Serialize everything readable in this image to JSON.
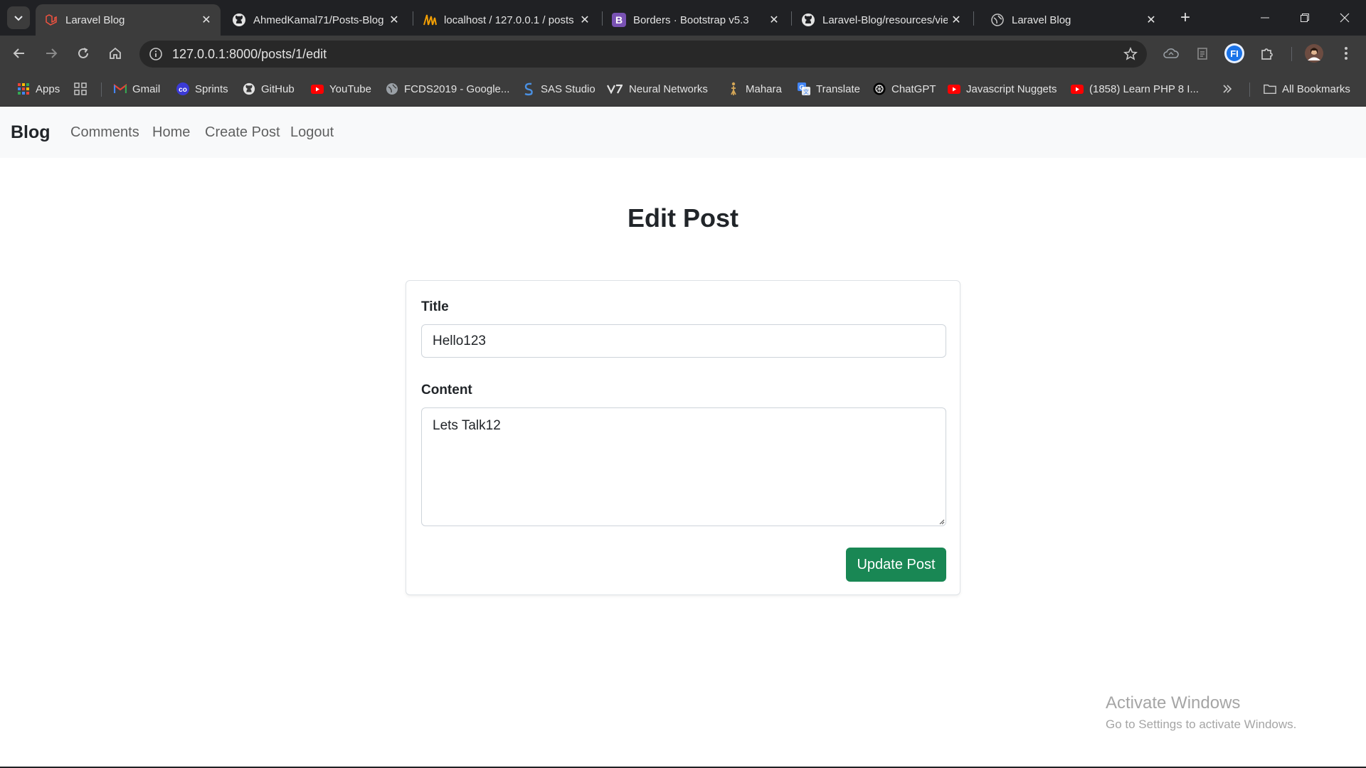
{
  "browser": {
    "tabs": [
      {
        "title": "Laravel Blog",
        "icon": "laravel-icon",
        "active": true
      },
      {
        "title": "AhmedKamal71/Posts-Blog",
        "icon": "github-icon",
        "active": false
      },
      {
        "title": "localhost / 127.0.0.1 / posts",
        "icon": "phpmyadmin-icon",
        "active": false
      },
      {
        "title": "Borders · Bootstrap v5.3",
        "icon": "bootstrap-icon",
        "active": false
      },
      {
        "title": "Laravel-Blog/resources/views",
        "icon": "github-icon",
        "active": false
      },
      {
        "title": "Laravel Blog",
        "icon": "globe-icon",
        "active": false
      }
    ],
    "url": "127.0.0.1:8000/posts/1/edit",
    "profile_badge": "FI",
    "bookmarks": [
      {
        "label": "Apps",
        "icon": "apps-grid-icon"
      },
      {
        "label": "",
        "icon": "tab-groups-icon"
      },
      {
        "label": "Gmail",
        "icon": "gmail-icon"
      },
      {
        "label": "Sprints",
        "icon": "sprints-icon"
      },
      {
        "label": "GitHub",
        "icon": "github-icon"
      },
      {
        "label": "YouTube",
        "icon": "youtube-icon"
      },
      {
        "label": "FCDS2019 - Google...",
        "icon": "globe-icon"
      },
      {
        "label": "SAS Studio",
        "icon": "sas-icon"
      },
      {
        "label": "Neural Networks",
        "icon": "v7-icon"
      },
      {
        "label": "Mahara",
        "icon": "mahara-icon"
      },
      {
        "label": "Translate",
        "icon": "translate-icon"
      },
      {
        "label": "ChatGPT",
        "icon": "chatgpt-icon"
      },
      {
        "label": "Javascript Nuggets",
        "icon": "youtube-icon"
      },
      {
        "label": "(1858) Learn PHP 8 I...",
        "icon": "youtube-icon"
      }
    ],
    "all_bookmarks": "All Bookmarks"
  },
  "navbar": {
    "brand": "Blog",
    "links": [
      "Comments",
      "Home",
      "Create Post",
      "Logout"
    ]
  },
  "page": {
    "title": "Edit Post",
    "form": {
      "title_label": "Title",
      "title_value": "Hello123",
      "content_label": "Content",
      "content_value": "Lets Talk12",
      "submit_label": "Update Post"
    }
  },
  "watermark": {
    "line1": "Activate Windows",
    "line2": "Go to Settings to activate Windows."
  },
  "colors": {
    "accent_success": "#198754",
    "navbar_bg": "#f8f9fa",
    "browser_dark": "#202124"
  }
}
